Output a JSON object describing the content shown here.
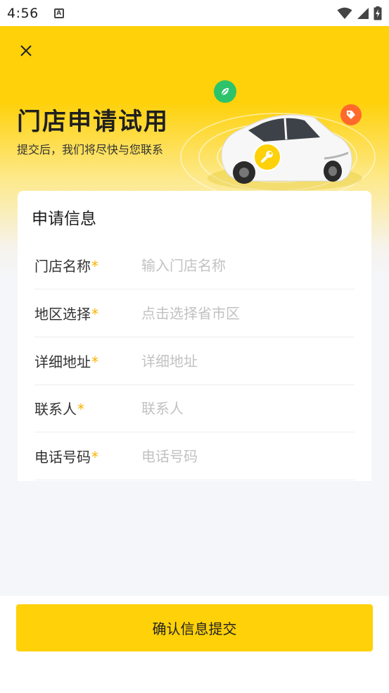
{
  "status_bar": {
    "time": "4:56",
    "notification_icon": "A",
    "icons": [
      "wifi-icon",
      "cell-signal-icon",
      "battery-charging-icon"
    ]
  },
  "header": {
    "close_icon": "close-icon",
    "title": "门店申请试用",
    "subtitle": "提交后，我们将尽快与您联系",
    "background_color": "#fed108"
  },
  "form": {
    "title": "申请信息",
    "required_mark": "*",
    "fields": [
      {
        "label": "门店名称",
        "placeholder": "输入门店名称",
        "value": ""
      },
      {
        "label": "地区选择",
        "placeholder": "点击选择省市区",
        "value": ""
      },
      {
        "label": "详细地址",
        "placeholder": "详细地址",
        "value": ""
      },
      {
        "label": "联系人",
        "placeholder": "联系人",
        "value": ""
      },
      {
        "label": "电话号码",
        "placeholder": "电话号码",
        "value": ""
      }
    ]
  },
  "footer": {
    "submit_label": "确认信息提交",
    "accent_color": "#fed108"
  },
  "colors": {
    "required_star": "#f6b300",
    "badge_green": "#2cc36b",
    "badge_orange": "#ff6a2c",
    "badge_yellow": "#fed108",
    "page_bg": "#f4f6fa"
  }
}
